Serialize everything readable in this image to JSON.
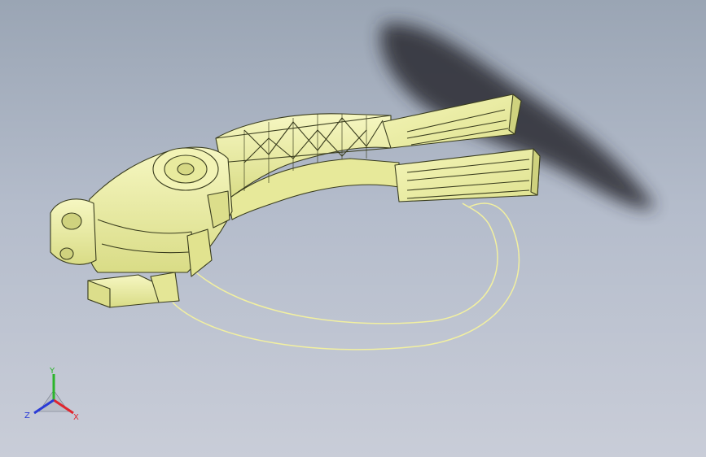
{
  "viewport": {
    "background_top": "#9aa5b4",
    "background_bottom": "#c9cdd8",
    "model_color": "#eef0a3",
    "edge_color": "#3a3d1e",
    "shadow_color": "#2a2c30"
  },
  "triad": {
    "x_label": "X",
    "y_label": "Y",
    "z_label": "Z",
    "x_color": "#e0262e",
    "y_color": "#2bb52b",
    "z_color": "#2a3bd6"
  }
}
